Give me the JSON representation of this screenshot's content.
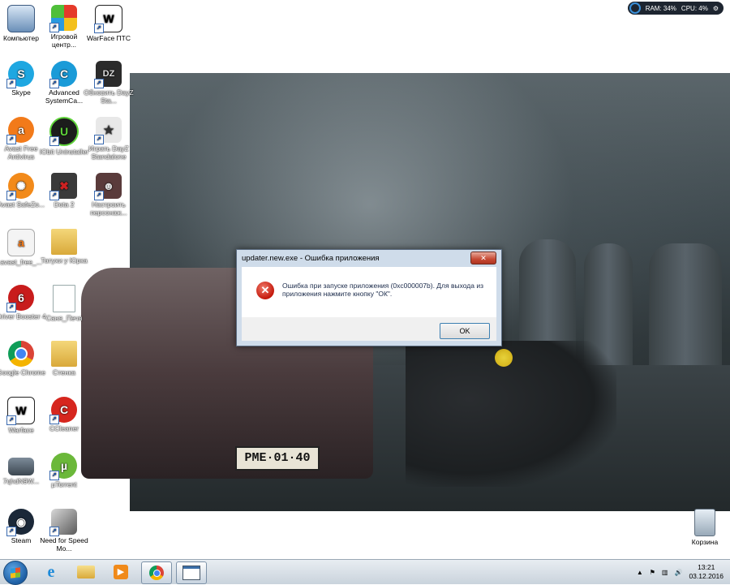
{
  "gadget": {
    "ram": "RAM: 34%",
    "cpu": "CPU: 4%"
  },
  "desktop_icons": [
    {
      "label": "Компьютер"
    },
    {
      "label": "Игровой центр..."
    },
    {
      "label": "WarFace ПТС"
    },
    {
      "label": "Skype"
    },
    {
      "label": "Advanced SystemCa..."
    },
    {
      "label": "Обновить DayZ Sta..."
    },
    {
      "label": "Avast Free Antivirus"
    },
    {
      "label": "IObit Uninstaller"
    },
    {
      "label": "Играть DayZ Standalone"
    },
    {
      "label": "Avast SafeZo..."
    },
    {
      "label": "Dota 2"
    },
    {
      "label": "Настроить персонаж..."
    },
    {
      "label": "avast_free_..."
    },
    {
      "label": "Татухи у Юрка"
    },
    {
      "label": "Driver Booster 4"
    },
    {
      "label": "Саня_Печя"
    },
    {
      "label": "Google Chrome"
    },
    {
      "label": "Стенка"
    },
    {
      "label": "Warface"
    },
    {
      "label": "CCleaner"
    },
    {
      "label": "7qhdN9W..."
    },
    {
      "label": "µTorrent"
    },
    {
      "label": "Steam"
    },
    {
      "label": "Need for Speed Mo..."
    },
    {
      "label": "Корзина"
    }
  ],
  "wallpaper": {
    "plate": "PME·01·40"
  },
  "dialog": {
    "title": "updater.new.exe - Ошибка приложения",
    "close": "✕",
    "message": "Ошибка при запуске приложения (0xc000007b). Для выхода из приложения нажмите кнопку \"ОК\".",
    "ok": "OK"
  },
  "taskbar": {
    "time": "13:21",
    "date": "03.12.2016"
  }
}
